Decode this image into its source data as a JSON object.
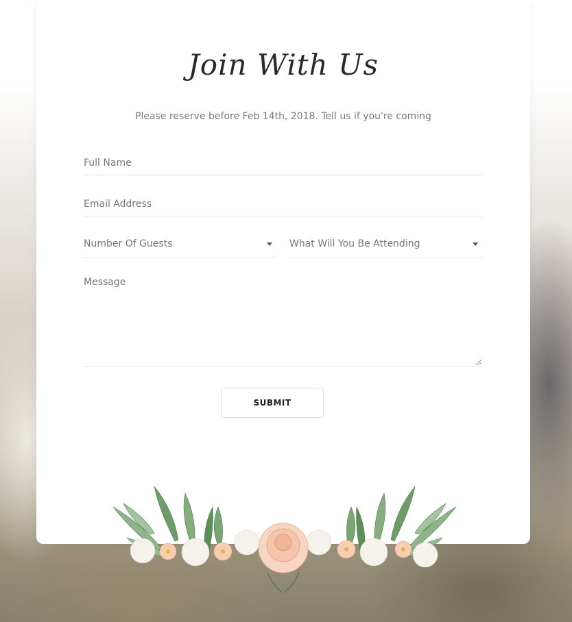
{
  "section": {
    "title": "Join With Us",
    "subtitle": "Please reserve before Feb 14th, 2018. Tell us if you're coming"
  },
  "form": {
    "full_name": {
      "value": "",
      "placeholder": "Full Name"
    },
    "email": {
      "value": "",
      "placeholder": "Email Address"
    },
    "guests": {
      "selected": "Number Of Guests"
    },
    "attending": {
      "selected": "What Will You Be Attending"
    },
    "message": {
      "value": "",
      "placeholder": "Message"
    },
    "submit_label": "SUBMIT"
  },
  "colors": {
    "text": "#777777",
    "title": "#2a2a2a",
    "border": "#e6e6e6",
    "leaf_green": "#5e8f5a",
    "rose_peach": "#f4c2a8"
  },
  "icons": {
    "caret": "caret-down-icon",
    "decoration": "floral-wreath"
  }
}
